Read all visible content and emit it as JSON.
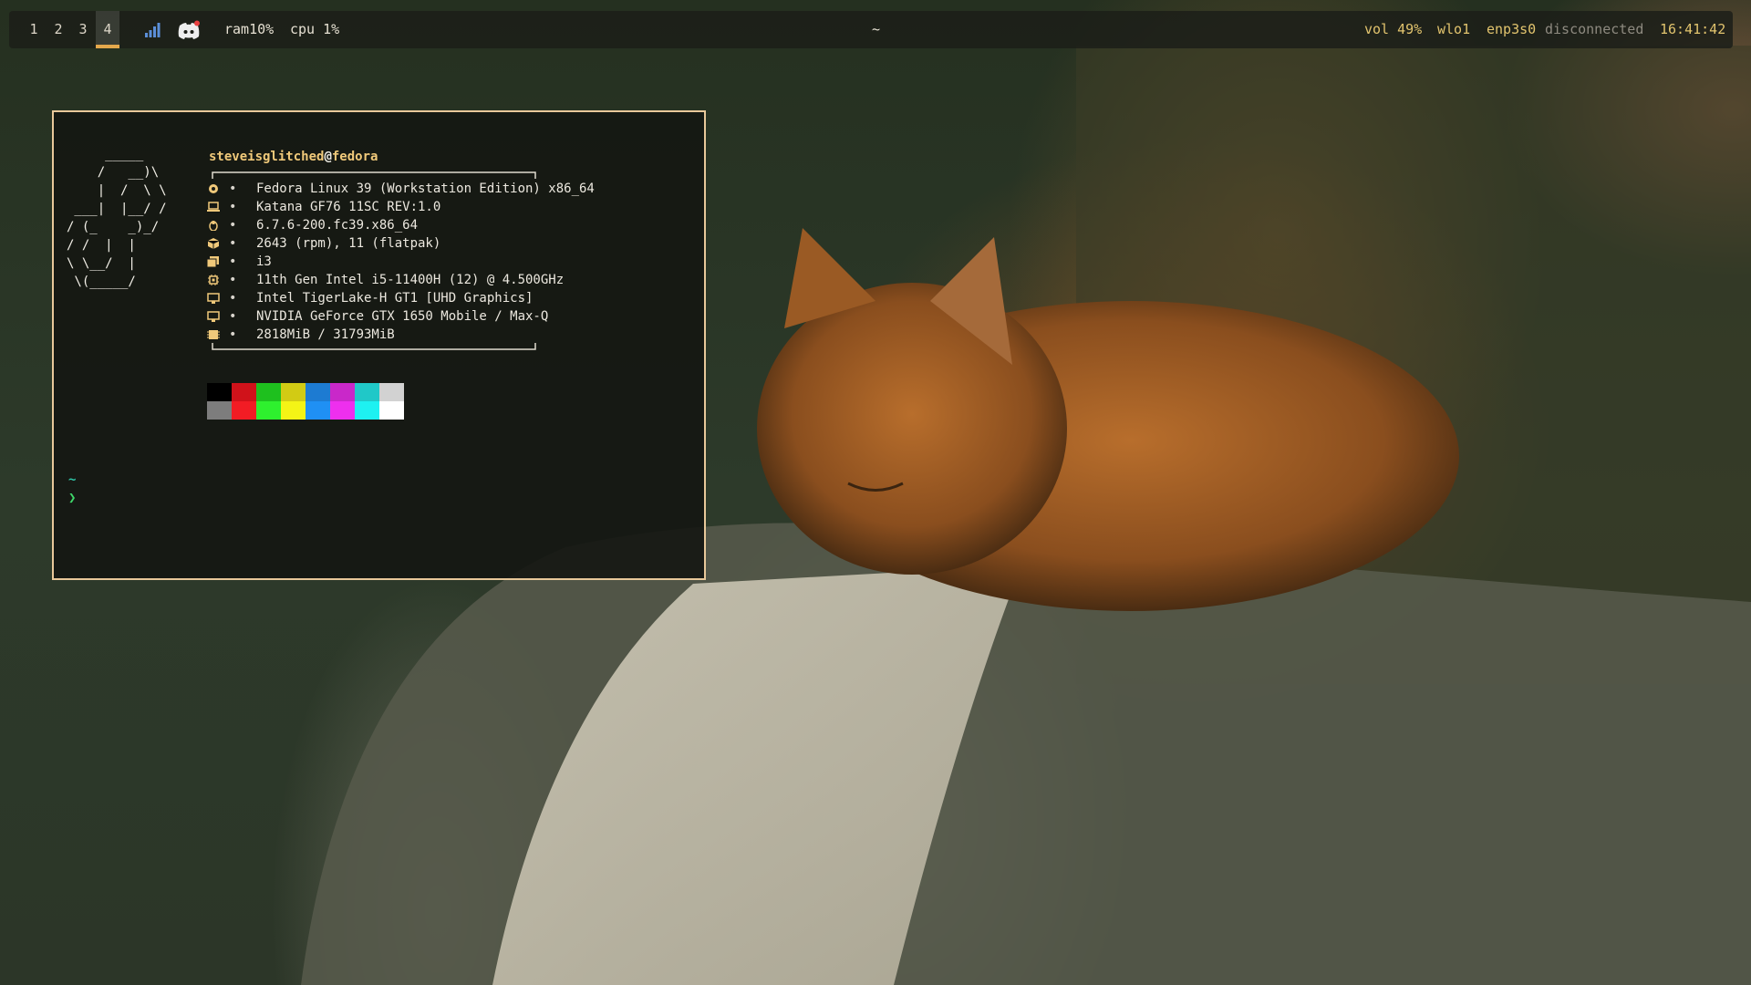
{
  "bar": {
    "workspaces": [
      "1",
      "2",
      "3",
      "4"
    ],
    "active_workspace": "4",
    "ram": "ram10%",
    "cpu": "cpu 1%",
    "title": "~",
    "vol": "vol 49%",
    "wlan": "wlo1",
    "eth_name": "enp3s0",
    "eth_status": "disconnected",
    "clock": "16:41:42",
    "icons": [
      "signal-bars-icon",
      "discord-icon"
    ]
  },
  "terminal": {
    "ascii_logo": "     _____\n    /   __)\\\n    |  /  \\ \\\n ___|  |__/ /\n/ (_    _)_/\n/ /  |  |\n\\ \\__/  |\n \\(_____/",
    "user": "steveisglitched",
    "at": "@",
    "host": "fedora",
    "bullet": "•",
    "info": [
      {
        "icon": "os-icon",
        "value": "Fedora Linux 39 (Workstation Edition) x86_64"
      },
      {
        "icon": "laptop-icon",
        "value": "Katana GF76 11SC REV:1.0"
      },
      {
        "icon": "linux-icon",
        "value": "6.7.6-200.fc39.x86_64"
      },
      {
        "icon": "package-icon",
        "value": "2643 (rpm), 11 (flatpak)"
      },
      {
        "icon": "window-manager-icon",
        "value": "i3"
      },
      {
        "icon": "cpu-icon",
        "value": "11th Gen Intel i5-11400H (12) @ 4.500GHz"
      },
      {
        "icon": "gpu-icon",
        "value": "Intel TigerLake-H GT1 [UHD Graphics]"
      },
      {
        "icon": "gpu-icon",
        "value": "NVIDIA GeForce GTX 1650 Mobile / Max-Q"
      },
      {
        "icon": "memory-icon",
        "value": "2818MiB / 31793MiB"
      }
    ],
    "palette_normal": [
      "#000000",
      "#d0121a",
      "#1ec01e",
      "#d2cb14",
      "#1d7bd2",
      "#c928c9",
      "#20c8c8",
      "#d2d2d2"
    ],
    "palette_bright": [
      "#7d7d7d",
      "#f21c24",
      "#2ef02e",
      "#f4f416",
      "#1f90f4",
      "#ee2fee",
      "#1ef1f1",
      "#ffffff"
    ],
    "prompt_dir": "~",
    "prompt_symbol": "❯"
  },
  "colors": {
    "accent": "#e4a84c",
    "border": "#e8c89a",
    "user": "#f0c97a"
  }
}
